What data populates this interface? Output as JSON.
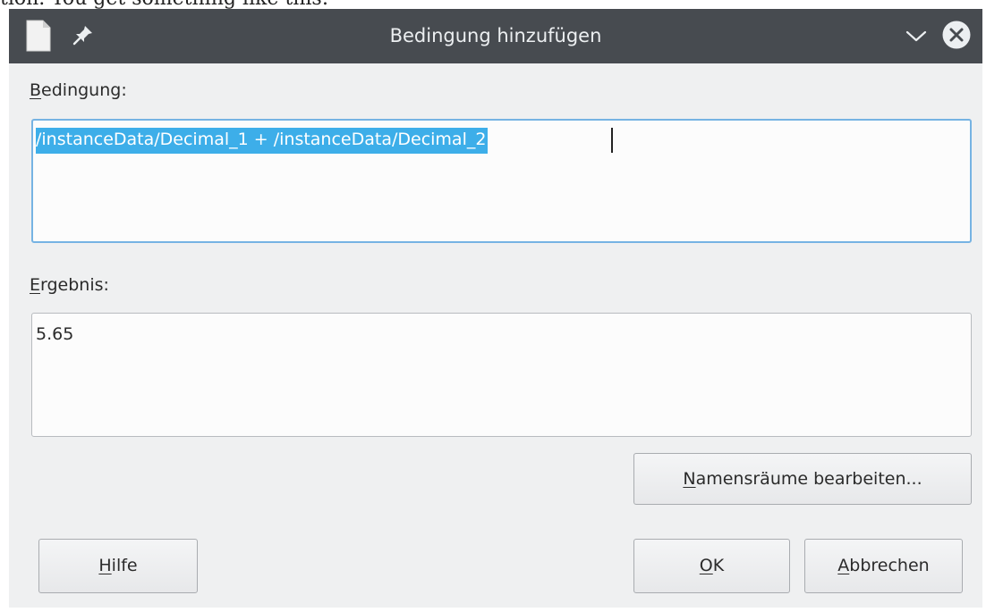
{
  "page_caption": "tion. You get something like this:",
  "window": {
    "title": "Bedingung hinzufügen",
    "icons": [
      "document-icon",
      "pin-icon",
      "chevron-down-icon",
      "close-icon"
    ]
  },
  "condition": {
    "label_mnemonic": "B",
    "label_rest": "edingung:",
    "value": "/instanceData/Decimal_1 + /instanceData/Decimal_2"
  },
  "result": {
    "label_mnemonic": "E",
    "label_rest": "rgebnis:",
    "value": "5.65"
  },
  "buttons": {
    "namespaces": {
      "mnemonic": "N",
      "rest": "amensräume bearbeiten..."
    },
    "help": {
      "mnemonic": "H",
      "rest": "ilfe"
    },
    "ok": {
      "mnemonic": "O",
      "rest": "K"
    },
    "cancel": {
      "mnemonic": "A",
      "rest": "bbrechen"
    }
  },
  "colors": {
    "titlebar": "#474b50",
    "selection": "#3daee9",
    "focus_border": "#76b3e3",
    "dialog_bg": "#eff0f1"
  }
}
